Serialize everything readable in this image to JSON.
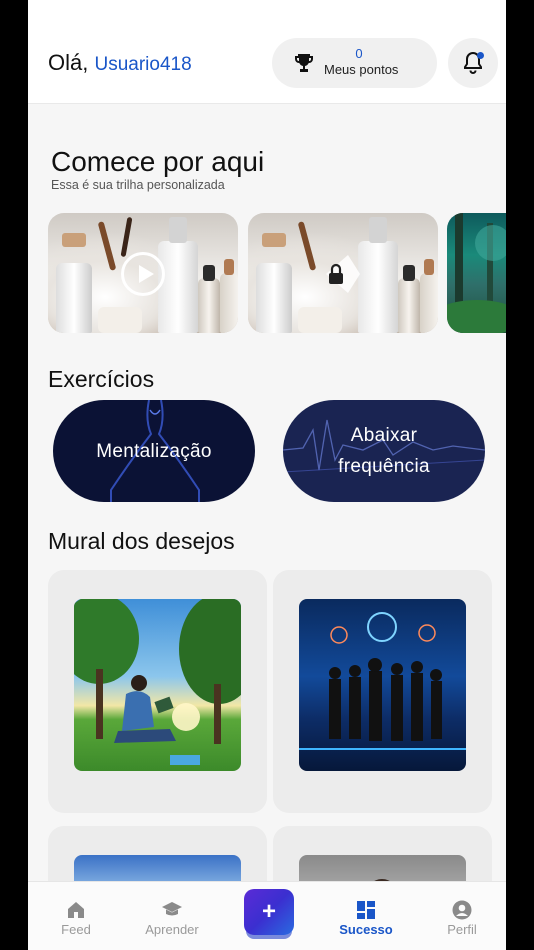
{
  "header": {
    "greeting": "Olá,",
    "username": "Usuario418",
    "points_value": "0",
    "points_label": "Meus pontos",
    "trophy_icon": "trophy-icon",
    "bell_icon": "bell-icon"
  },
  "start_section": {
    "title": "Comece por aqui",
    "subtitle": "Essa é sua trilha personalizada",
    "items": [
      {
        "icon": "play-icon",
        "image": "cosmetic-bottles"
      },
      {
        "icon": "lock-icon",
        "image": "cosmetic-bottles"
      },
      {
        "image": "forest-landscape"
      }
    ]
  },
  "exercises": {
    "title": "Exercícios",
    "items": [
      {
        "label": "Mentalização"
      },
      {
        "label": "Abaixar frequência"
      }
    ]
  },
  "mural": {
    "title": "Mural dos desejos",
    "cards": [
      {
        "image": "man-reading-in-park"
      },
      {
        "image": "business-team-futuristic"
      },
      {
        "image": "sky-landscape"
      },
      {
        "image": "portrait"
      }
    ]
  },
  "nav": {
    "items": [
      {
        "label": "Feed",
        "icon": "home-icon",
        "active": false
      },
      {
        "label": "Aprender",
        "icon": "graduation-cap-icon",
        "active": false
      },
      {
        "label": "Sucesso",
        "icon": "grid-icon",
        "active": true
      },
      {
        "label": "Perfil",
        "icon": "user-circle-icon",
        "active": false
      }
    ],
    "add_label": "+"
  },
  "colors": {
    "accent": "#1a56c8",
    "fab_start": "#5b2bd6",
    "fab_end": "#2a6be0",
    "pill_bg": "#0b1235"
  }
}
